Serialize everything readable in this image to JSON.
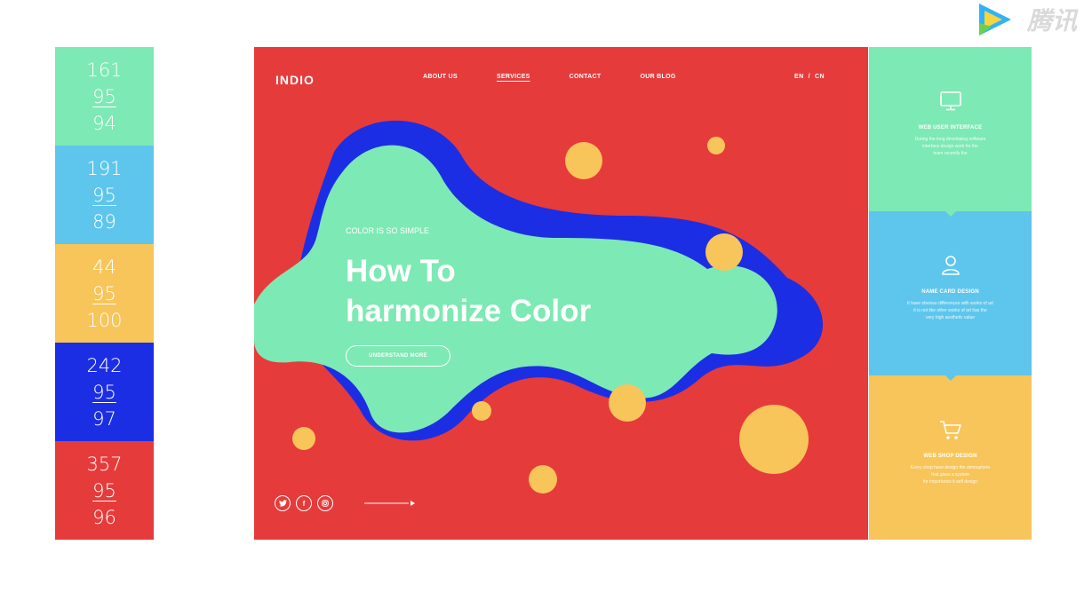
{
  "swatches": [
    {
      "h": "161",
      "s": "95",
      "b": "94",
      "color": "#7de9b4"
    },
    {
      "h": "191",
      "s": "95",
      "b": "89",
      "color": "#5ec6ec"
    },
    {
      "h": "44",
      "s": "95",
      "b": "100",
      "color": "#f8c55a"
    },
    {
      "h": "242",
      "s": "95",
      "b": "97",
      "color": "#1c2ee4"
    },
    {
      "h": "357",
      "s": "95",
      "b": "96",
      "color": "#e63b3b"
    }
  ],
  "hero": {
    "logo": "INDIO",
    "nav": [
      "ABOUT US",
      "SERVICES",
      "CONTACT",
      "OUR BLOG"
    ],
    "lang": "EN  /  CN",
    "tagline": "COLOR IS SO SIMPLE",
    "headline_line1": "How To",
    "headline_line2": "harmonize Color",
    "cta": "UNDERSTAND MORE",
    "social_icons": [
      "twitter-icon",
      "facebook-icon",
      "instagram-icon"
    ],
    "colors": {
      "background": "#e63b3b",
      "blob": "#7de9b4",
      "blob_shadow": "#1c2ee4",
      "dots": "#f8c55a"
    }
  },
  "cards": [
    {
      "title": "WEB USER INTERFACE",
      "icon": "monitor-icon",
      "color": "#7de9b4",
      "desc": [
        "During the long developing software",
        "interface design work for the",
        "team recently the"
      ]
    },
    {
      "title": "NAME CARD DESIGN",
      "icon": "user-icon",
      "color": "#5ec6ec",
      "desc": [
        "It have obvious differences with works of art",
        "it is not like other works of art has the",
        "very high aesthetic value"
      ]
    },
    {
      "title": "WEB SHOP DESIGN",
      "icon": "cart-icon",
      "color": "#f8c55a",
      "desc": [
        "Every shop have design the atmosphere",
        "that gives a system",
        "for importance it self design"
      ]
    }
  ],
  "watermark": {
    "text": "腾讯"
  }
}
